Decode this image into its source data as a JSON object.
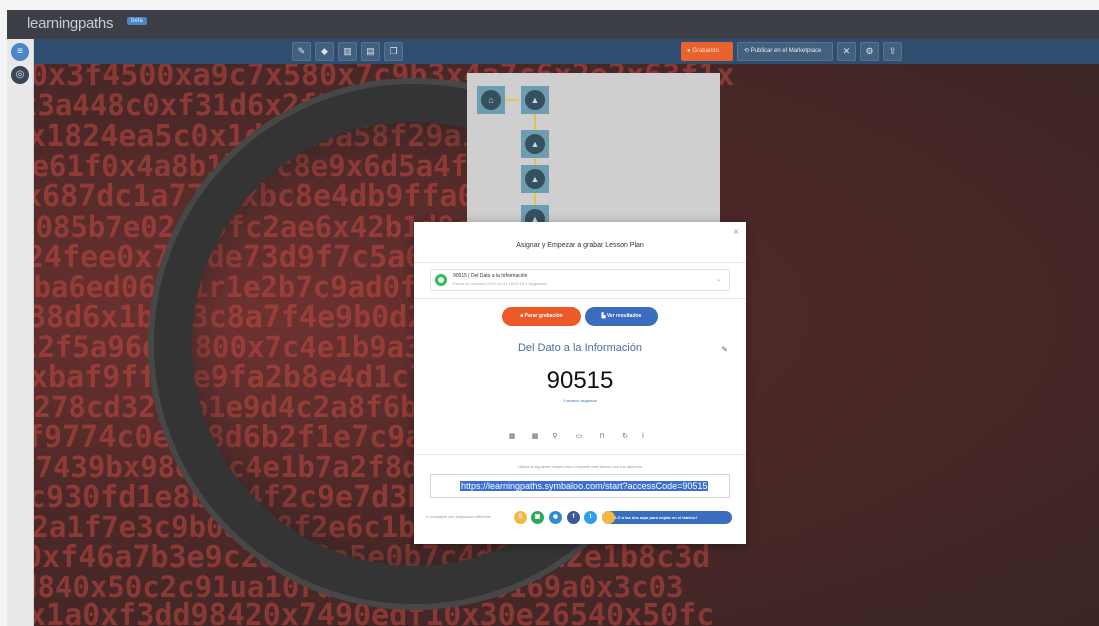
{
  "brand": {
    "name": "learningpaths",
    "badge": "beta"
  },
  "toolbar": {
    "tools": [
      {
        "icon": "pencil-icon",
        "glyph": "✎"
      },
      {
        "icon": "tag-icon",
        "glyph": "◆"
      },
      {
        "icon": "chart-icon",
        "glyph": "▥"
      },
      {
        "icon": "document-icon",
        "glyph": "▤"
      },
      {
        "icon": "copy-icon",
        "glyph": "❐"
      }
    ],
    "right": {
      "record_label": "● Grabando",
      "publish_label": "⟲ Publicar en el Marketplace",
      "close_glyph": "✕",
      "settings_glyph": "⚙",
      "share_glyph": "⇪"
    }
  },
  "sidebar": {
    "menu_glyph": "≡",
    "globe_glyph": "◎"
  },
  "background": {
    "rows": [
      "0x3f4500xa9c7x580x7c9b3x4a7c6x2e2x63f1x",
      "x3a448c0xf31d6x2f5a3d9b4ae11x7c9bx8d2e",
      "x1824ea5c0x1d40x3a58f29a1ad2fx3a29f7b2",
      "2e61f0x4a8b1b7fc8e9x6d5a4f7b1e7fac0x62",
      "x687dc1a7730xbc8e4db9ffa04c1f5dc04f1bb",
      "6085b7e02ab9fc2ae6x42b1d8e7a7x2d20fa7b",
      "24fee0x7a1de73d9f7c5a6fa9e3x02d7b41f2c",
      "9ba6ed064vir1e2b7c9ad0fe1ef0x9c2f7a1b4",
      "38d6x1b5e3c8a7f4e9b0d2c6a3f8e1b7d4c9a2",
      "x2f5a96d83800x7c4e1b9a3f6d0e8c2b5a7f41",
      "xbaf9ffb6e9fa2b8e4d1c7a3f6b0e9d2c5a8f7",
      "6278cd32f7b1e9d4c2a8f6b3e0d7c1a5f9b4e2",
      "f9774c0e3a8d6b2f1e7c9a4d5b0e8f3c6a1d72",
      "37439bx98e09c4e1b7a2f8d3c6e0b5a9f1d7c4",
      "c930fd1e8b6a4f2c9e7d3b0a5f1c8e6d2b9a73",
      "x2a1f7e3c9b0d5a8f2e6c1b4d7a9f3e0c8b5d6",
      "0xf46a7b3e9c2d1f8a5e0b7c4d6f9a2e1b8c3d",
      "d840x50c2c91ua10rdb27a0xed00169a0x3c03",
      "x1a0xf3dd98420x7490edf10x30e26540x50fc"
    ]
  },
  "path_map": {
    "nodes": [
      {
        "icon": "home-icon",
        "glyph": "⌂"
      },
      {
        "icon": "graduation-cap-icon",
        "glyph": "▲"
      },
      {
        "icon": "graduation-cap-icon",
        "glyph": "▲"
      },
      {
        "icon": "graduation-cap-icon",
        "glyph": "▲"
      },
      {
        "icon": "graduation-cap-icon",
        "glyph": "▲"
      }
    ]
  },
  "modal": {
    "close_glyph": "×",
    "title": "Asignar y Empezar a grabar Lesson Plan",
    "selection": {
      "title": "90515 | Del Dato a la Información",
      "subtitle": "Fecha de creación 2020-10-31 18:32:26 1 asignados",
      "chevron": "⌄"
    },
    "stop_button": "■ Parar grabación",
    "results_button": "▙ Ver resultados",
    "lesson_name": "Del Dato a la Información",
    "edit_glyph": "✎",
    "access_code": "90515",
    "assigned_text": "1 alumno asignado",
    "actions": [
      {
        "icon": "calendar-icon",
        "glyph": "▦"
      },
      {
        "icon": "comment-icon",
        "glyph": "▩"
      },
      {
        "icon": "pin-icon",
        "glyph": "⚲"
      },
      {
        "icon": "embed-icon",
        "glyph": "▭"
      },
      {
        "icon": "unlock-icon",
        "glyph": "⊓"
      },
      {
        "icon": "refresh-icon",
        "glyph": "↻"
      },
      {
        "icon": "info-icon",
        "glyph": "ⅰ"
      }
    ],
    "link_instruction": "Utiliza el siguiente enlace para compartir este lesson con tus alumnos",
    "access_link": "https://learningpaths.symbaloo.com/start?accessCode=90515",
    "share_label": "O comparte con asignación diferente",
    "share": [
      {
        "icon": "symbaloo-share-icon",
        "glyph": "S",
        "color": "#f4b942"
      },
      {
        "icon": "classroom-icon",
        "glyph": "▣",
        "color": "#2fa85a"
      },
      {
        "icon": "teams-icon",
        "glyph": "◉",
        "color": "#2f8bd0"
      },
      {
        "icon": "facebook-icon",
        "glyph": "f",
        "color": "#3b5998"
      },
      {
        "icon": "twitter-icon",
        "glyph": "t",
        "color": "#2f9fe8"
      }
    ],
    "share_pill": "¡DALO a las dos aquí para copiar en el tablero!"
  }
}
